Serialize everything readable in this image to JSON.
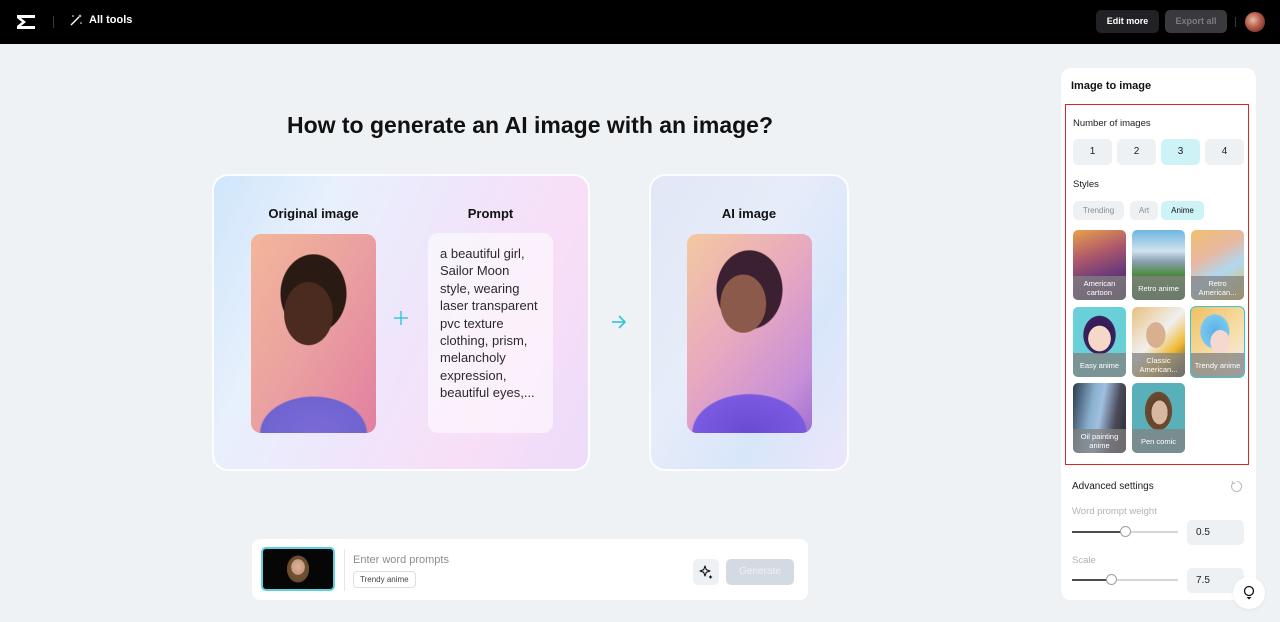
{
  "topbar": {
    "logo": "capcut-logo-icon",
    "all_tools_label": "All tools",
    "all_tools_icon": "magic-wand-icon",
    "edit_more_label": "Edit more",
    "export_all_label": "Export all",
    "avatar": "user-avatar"
  },
  "main": {
    "title": "How to generate an AI image with an image?",
    "original_image_label": "Original image",
    "prompt_label": "Prompt",
    "ai_image_label": "AI image",
    "prompt_text": "a beautiful girl, Sailor Moon style, wearing laser transparent pvc texture clothing, prism, melancholy expression, beautiful eyes,...",
    "plus_icon": "plus-icon",
    "arrow_icon": "arrow-right-icon"
  },
  "prompt_bar": {
    "placeholder": "Enter word prompts",
    "value": "",
    "style_tag": "Trendy anime",
    "magic_icon": "sparkle-icon",
    "generate_label": "Generate"
  },
  "panel": {
    "title": "Image to image",
    "number_of_images_label": "Number of images",
    "number_options": [
      "1",
      "2",
      "3",
      "4"
    ],
    "number_selected": "3",
    "styles_label": "Styles",
    "style_tabs": [
      "Trending",
      "Art",
      "Anime"
    ],
    "style_tab_selected": "Anime",
    "styles": [
      {
        "label": "American cartoon"
      },
      {
        "label": "Retro anime"
      },
      {
        "label": "Retro American..."
      },
      {
        "label": "Easy anime"
      },
      {
        "label": "Classic American..."
      },
      {
        "label": "Trendy anime",
        "selected": true
      },
      {
        "label": "Oil painting anime"
      },
      {
        "label": "Pen comic"
      }
    ],
    "advanced_settings_label": "Advanced settings",
    "word_prompt_weight_label": "Word prompt weight",
    "word_prompt_weight_value": "0.5",
    "word_prompt_weight_fraction": 0.5,
    "scale_label": "Scale",
    "scale_value": "7.5",
    "scale_fraction": 0.37
  },
  "colors": {
    "accent": "#38c4d8",
    "selected_bg": "#cdf3f6",
    "highlight_border": "#e0222a",
    "topbar_bg": "#000000",
    "page_bg": "#eef2f5"
  }
}
